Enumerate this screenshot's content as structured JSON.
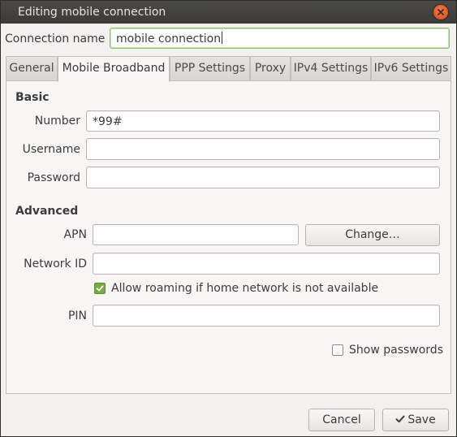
{
  "window": {
    "title": "Editing mobile connection"
  },
  "connection_name": {
    "label": "Connection name",
    "value": "mobile connection"
  },
  "tabs": [
    {
      "label": "General"
    },
    {
      "label": "Mobile Broadband",
      "active": true
    },
    {
      "label": "PPP Settings"
    },
    {
      "label": "Proxy"
    },
    {
      "label": "IPv4 Settings"
    },
    {
      "label": "IPv6 Settings"
    }
  ],
  "basic": {
    "heading": "Basic",
    "number_label": "Number",
    "number_value": "*99#",
    "username_label": "Username",
    "username_value": "",
    "password_label": "Password",
    "password_value": ""
  },
  "advanced": {
    "heading": "Advanced",
    "apn_label": "APN",
    "apn_value": "",
    "change_button": "Change…",
    "network_id_label": "Network ID",
    "network_id_value": "",
    "roaming_label": "Allow roaming if home network is not available",
    "roaming_checked": true,
    "pin_label": "PIN",
    "pin_value": ""
  },
  "show_passwords": {
    "label": "Show passwords",
    "checked": false
  },
  "footer": {
    "cancel_label": "Cancel",
    "save_label": "Save"
  },
  "colors": {
    "titlebar": "#3c3b37",
    "close_button": "#e05a22",
    "checkbox_checked": "#78ab46",
    "focus_border": "#87c06a"
  },
  "icons": {
    "close": "close-icon",
    "check": "checkmark-icon",
    "save": "checkmark-icon"
  }
}
